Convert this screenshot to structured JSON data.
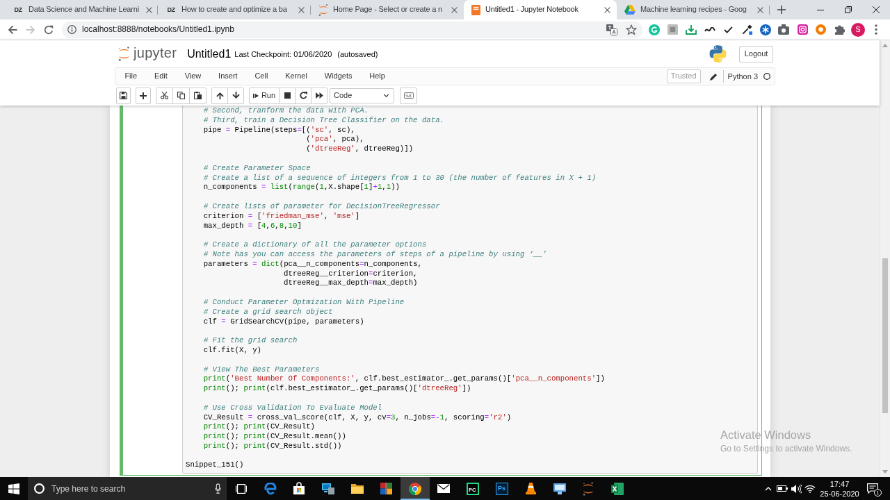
{
  "browser": {
    "tabs": [
      {
        "favicon": {
          "kind": "letters",
          "text": "DZ"
        },
        "title": "Data Science and Machine Learni",
        "selected": false
      },
      {
        "favicon": {
          "kind": "letters",
          "text": "DZ"
        },
        "title": "How to create and optimize a ba",
        "selected": false
      },
      {
        "favicon": {
          "kind": "ring"
        },
        "title": "Home Page - Select or create a n",
        "selected": false
      },
      {
        "favicon": {
          "kind": "notebook"
        },
        "title": "Untitled1 - Jupyter Notebook",
        "selected": true
      },
      {
        "favicon": {
          "kind": "drive"
        },
        "title": "Machine learning recipes - Goog",
        "selected": false
      }
    ],
    "back": {
      "disabled": false
    },
    "forward": {
      "disabled": true
    },
    "address": "localhost:8888/notebooks/Untitled1.ipynb",
    "profile_initial": "S"
  },
  "notebook": {
    "logo_text": "jupyter",
    "name": "Untitled1",
    "checkpoint": "Last Checkpoint: 01/06/2020",
    "save_status": "(autosaved)",
    "logout": "Logout",
    "menu": [
      "File",
      "Edit",
      "View",
      "Insert",
      "Cell",
      "Kernel",
      "Widgets",
      "Help"
    ],
    "trusted": "Trusted",
    "kernel": {
      "name": "Python 3",
      "busy": false
    },
    "toolbar": {
      "run": "Run",
      "cell_type": "Code"
    },
    "cell": {
      "editing": true,
      "blocks": [
        {
          "lines": [
            [
              {
                "kind": "comment",
                "text": "    # Second, tranform the data with PCA."
              }
            ],
            [
              {
                "kind": "comment",
                "text": "    # Third, train a Decision Tree Classifier on the data."
              }
            ],
            [
              {
                "kind": "plain",
                "text": "    pipe "
              },
              {
                "kind": "operator",
                "text": "="
              },
              {
                "kind": "plain",
                "text": " Pipeline(steps"
              },
              {
                "kind": "operator",
                "text": "="
              },
              {
                "kind": "plain",
                "text": "[("
              },
              {
                "kind": "string",
                "text": "'sc'"
              },
              {
                "kind": "plain",
                "text": ", sc),"
              }
            ],
            [
              {
                "kind": "plain",
                "text": "                           ("
              },
              {
                "kind": "string",
                "text": "'pca'"
              },
              {
                "kind": "plain",
                "text": ", pca),"
              }
            ],
            [
              {
                "kind": "plain",
                "text": "                           ("
              },
              {
                "kind": "string",
                "text": "'dtreeReg'"
              },
              {
                "kind": "plain",
                "text": ", dtreeReg)])"
              }
            ]
          ]
        },
        {
          "lines": [
            [
              {
                "kind": "comment",
                "text": "    # Create Parameter Space"
              }
            ],
            [
              {
                "kind": "comment",
                "text": "    # Create a list of a sequence of integers from 1 to 30 (the number of features in X + 1)"
              }
            ],
            [
              {
                "kind": "plain",
                "text": "    n_components "
              },
              {
                "kind": "operator",
                "text": "="
              },
              {
                "kind": "builtin",
                "text": " list"
              },
              {
                "kind": "plain",
                "text": "("
              },
              {
                "kind": "builtin",
                "text": "range"
              },
              {
                "kind": "plain",
                "text": "("
              },
              {
                "kind": "number",
                "text": "1"
              },
              {
                "kind": "plain",
                "text": ",X.shape["
              },
              {
                "kind": "number",
                "text": "1"
              },
              {
                "kind": "plain",
                "text": "]"
              },
              {
                "kind": "operator",
                "text": "+"
              },
              {
                "kind": "number",
                "text": "1"
              },
              {
                "kind": "plain",
                "text": ","
              },
              {
                "kind": "number",
                "text": "1"
              },
              {
                "kind": "plain",
                "text": "))"
              }
            ]
          ]
        },
        {
          "lines": [
            [
              {
                "kind": "comment",
                "text": "    # Create lists of parameter for DecisionTreeRegressor"
              }
            ],
            [
              {
                "kind": "plain",
                "text": "    criterion "
              },
              {
                "kind": "operator",
                "text": "="
              },
              {
                "kind": "plain",
                "text": " ["
              },
              {
                "kind": "string",
                "text": "'friedman_mse'"
              },
              {
                "kind": "plain",
                "text": ", "
              },
              {
                "kind": "string",
                "text": "'mse'"
              },
              {
                "kind": "plain",
                "text": "]"
              }
            ],
            [
              {
                "kind": "plain",
                "text": "    max_depth "
              },
              {
                "kind": "operator",
                "text": "="
              },
              {
                "kind": "plain",
                "text": " ["
              },
              {
                "kind": "number",
                "text": "4"
              },
              {
                "kind": "plain",
                "text": ","
              },
              {
                "kind": "number",
                "text": "6"
              },
              {
                "kind": "plain",
                "text": ","
              },
              {
                "kind": "number",
                "text": "8"
              },
              {
                "kind": "plain",
                "text": ","
              },
              {
                "kind": "number",
                "text": "10"
              },
              {
                "kind": "plain",
                "text": "]"
              }
            ]
          ]
        },
        {
          "lines": [
            [
              {
                "kind": "comment",
                "text": "    # Create a dictionary of all the parameter options"
              }
            ],
            [
              {
                "kind": "comment",
                "text": "    # Note has you can access the parameters of steps of a pipeline by using ‘__’"
              }
            ],
            [
              {
                "kind": "plain",
                "text": "    parameters "
              },
              {
                "kind": "operator",
                "text": "="
              },
              {
                "kind": "builtin",
                "text": " dict"
              },
              {
                "kind": "plain",
                "text": "(pca__n_components"
              },
              {
                "kind": "operator",
                "text": "="
              },
              {
                "kind": "plain",
                "text": "n_components,"
              }
            ],
            [
              {
                "kind": "plain",
                "text": "                      dtreeReg__criterion"
              },
              {
                "kind": "operator",
                "text": "="
              },
              {
                "kind": "plain",
                "text": "criterion,"
              }
            ],
            [
              {
                "kind": "plain",
                "text": "                      dtreeReg__max_depth"
              },
              {
                "kind": "operator",
                "text": "="
              },
              {
                "kind": "plain",
                "text": "max_depth)"
              }
            ]
          ]
        },
        {
          "lines": [
            [
              {
                "kind": "comment",
                "text": "    # Conduct Parameter Optmization With Pipeline"
              }
            ],
            [
              {
                "kind": "comment",
                "text": "    # Create a grid search object"
              }
            ],
            [
              {
                "kind": "plain",
                "text": "    clf "
              },
              {
                "kind": "operator",
                "text": "="
              },
              {
                "kind": "plain",
                "text": " GridSearchCV(pipe, parameters)"
              }
            ]
          ]
        },
        {
          "lines": [
            [
              {
                "kind": "comment",
                "text": "    # Fit the grid search"
              }
            ],
            [
              {
                "kind": "plain",
                "text": "    clf.fit(X, y)"
              }
            ]
          ]
        },
        {
          "lines": [
            [
              {
                "kind": "comment",
                "text": "    # View The Best Parameters"
              }
            ],
            [
              {
                "kind": "builtin",
                "text": "    print"
              },
              {
                "kind": "plain",
                "text": "("
              },
              {
                "kind": "string",
                "text": "'Best Number Of Components:'"
              },
              {
                "kind": "plain",
                "text": ", clf.best_estimator_.get_params()["
              },
              {
                "kind": "string",
                "text": "'pca__n_components'"
              },
              {
                "kind": "plain",
                "text": "])"
              }
            ],
            [
              {
                "kind": "builtin",
                "text": "    print"
              },
              {
                "kind": "plain",
                "text": "(); "
              },
              {
                "kind": "builtin",
                "text": "print"
              },
              {
                "kind": "plain",
                "text": "(clf.best_estimator_.get_params()["
              },
              {
                "kind": "string",
                "text": "'dtreeReg'"
              },
              {
                "kind": "plain",
                "text": "])"
              }
            ]
          ]
        },
        {
          "lines": [
            [
              {
                "kind": "comment",
                "text": "    # Use Cross Validation To Evaluate Model"
              }
            ],
            [
              {
                "kind": "plain",
                "text": "    CV_Result "
              },
              {
                "kind": "operator",
                "text": "="
              },
              {
                "kind": "plain",
                "text": " cross_val_score(clf, X, y, cv"
              },
              {
                "kind": "operator",
                "text": "="
              },
              {
                "kind": "number",
                "text": "3"
              },
              {
                "kind": "plain",
                "text": ", n_jobs"
              },
              {
                "kind": "operator",
                "text": "=-"
              },
              {
                "kind": "number",
                "text": "1"
              },
              {
                "kind": "plain",
                "text": ", scoring"
              },
              {
                "kind": "operator",
                "text": "="
              },
              {
                "kind": "string",
                "text": "'r2'"
              },
              {
                "kind": "plain",
                "text": ")"
              }
            ],
            [
              {
                "kind": "builtin",
                "text": "    print"
              },
              {
                "kind": "plain",
                "text": "(); "
              },
              {
                "kind": "builtin",
                "text": "print"
              },
              {
                "kind": "plain",
                "text": "(CV_Result)"
              }
            ],
            [
              {
                "kind": "builtin",
                "text": "    print"
              },
              {
                "kind": "plain",
                "text": "(); "
              },
              {
                "kind": "builtin",
                "text": "print"
              },
              {
                "kind": "plain",
                "text": "(CV_Result.mean())"
              }
            ],
            [
              {
                "kind": "builtin",
                "text": "    print"
              },
              {
                "kind": "plain",
                "text": "(); "
              },
              {
                "kind": "builtin",
                "text": "print"
              },
              {
                "kind": "plain",
                "text": "(CV_Result.std())"
              }
            ]
          ]
        },
        {
          "lines": [
            [
              {
                "kind": "plain",
                "text": "Snippet_151()"
              }
            ]
          ]
        }
      ]
    }
  },
  "overlay": {
    "title": "Activate Windows",
    "text": "Go to Settings to activate Windows."
  },
  "taskbar": {
    "search": {
      "placeholder": "Type here to search"
    },
    "apps": [
      {
        "kind": "edge",
        "selected": false
      },
      {
        "kind": "store",
        "selected": false
      },
      {
        "kind": "computer",
        "selected": false
      },
      {
        "kind": "folder",
        "selected": false
      },
      {
        "kind": "blocks",
        "selected": false
      },
      {
        "kind": "chrome",
        "selected": true
      },
      {
        "kind": "mail",
        "selected": false
      },
      {
        "kind": "pycharm",
        "text": "PC",
        "selected": false
      },
      {
        "kind": "photoshop",
        "text": "Ps",
        "selected": false
      },
      {
        "kind": "vlc",
        "selected": false
      },
      {
        "kind": "screen",
        "selected": false
      },
      {
        "kind": "jupyter",
        "selected": false
      },
      {
        "kind": "excel",
        "selected": false
      }
    ],
    "time": "17:47",
    "date": "25-06-2020",
    "notifications": "1"
  }
}
